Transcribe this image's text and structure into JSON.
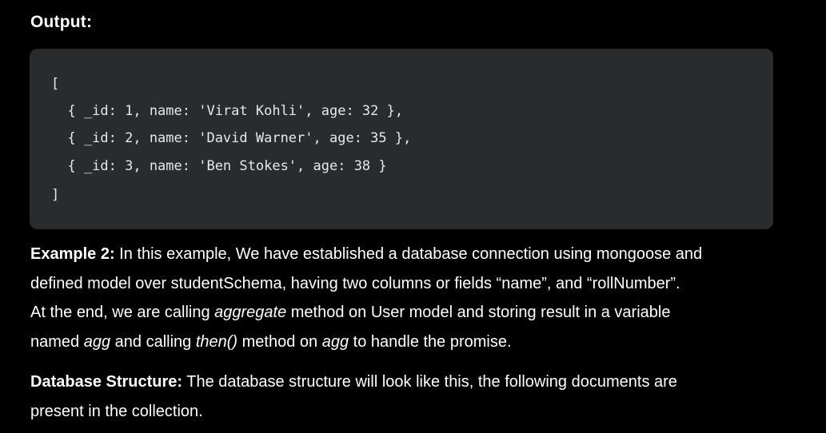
{
  "output_heading": "Output:",
  "code_block": {
    "lines": [
      "[",
      "  { _id: 1, name: 'Virat Kohli', age: 32 },",
      "  { _id: 2, name: 'David Warner', age: 35 },",
      "  { _id: 3, name: 'Ben Stokes', age: 38 }",
      "]"
    ]
  },
  "example2": {
    "lead": "Example 2:",
    "line1": " In this example, We have established a database connection using mongoose and",
    "line2": "defined model over studentSchema, having two columns or fields “name”,  and “rollNumber”.",
    "line3a": "At the end, we are calling ",
    "line3_em": "aggregate",
    "line3b": " method on User model and storing result in a variable",
    "line4a": "named ",
    "line4_em1": "agg",
    "line4b": " and calling ",
    "line4_em2": "then()",
    "line4c": " method on ",
    "line4_em3": "agg",
    "line4d": " to handle the promise."
  },
  "db_structure": {
    "lead": "Database Structure:",
    "line1": " The database structure will look like this, the following documents are",
    "line2": "present in the collection."
  }
}
